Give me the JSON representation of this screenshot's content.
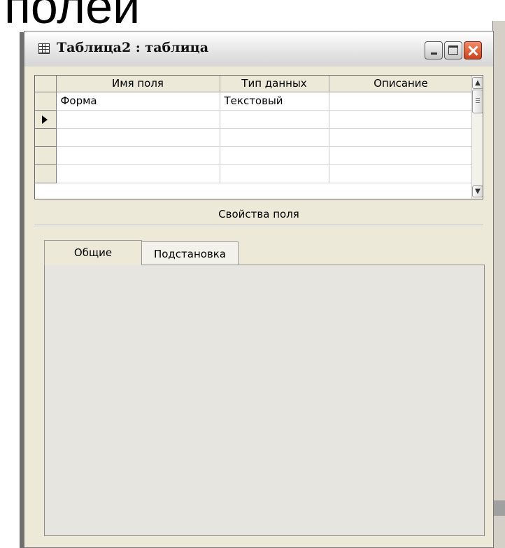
{
  "slide": {
    "heading": "полей"
  },
  "window": {
    "title": "Таблица2 : таблица",
    "icon": "table-icon",
    "controls": {
      "minimize": "minimize-icon",
      "maximize": "maximize-icon",
      "close": "close-icon"
    }
  },
  "grid": {
    "columns": [
      "Имя поля",
      "Тип данных",
      "Описание"
    ],
    "rows": [
      {
        "name": "Форма",
        "type": "Текстовый",
        "description": ""
      },
      {
        "name": "",
        "type": "",
        "description": "",
        "current": true
      },
      {
        "name": "",
        "type": "",
        "description": ""
      },
      {
        "name": "",
        "type": "",
        "description": ""
      },
      {
        "name": "",
        "type": "",
        "description": ""
      }
    ]
  },
  "properties": {
    "label": "Свойства поля",
    "tabs": [
      {
        "label": "Общие",
        "active": true
      },
      {
        "label": "Подстановка",
        "active": false
      }
    ]
  }
}
